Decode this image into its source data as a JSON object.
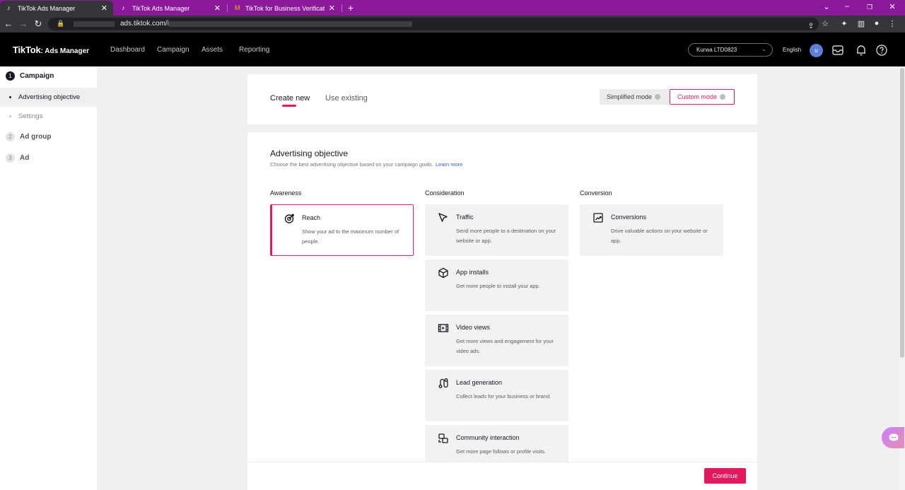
{
  "browser": {
    "tabs": [
      {
        "title": "TikTok Ads Manager",
        "active": true
      },
      {
        "title": "TikTok Ads Manager",
        "active": false
      },
      {
        "title": "TikTok for Business Verification C",
        "active": false
      }
    ],
    "url": "ads.tiktok.com/i"
  },
  "header": {
    "logo": "TikTok",
    "logo_sub": ": Ads Manager",
    "nav": [
      "Dashboard",
      "Campaign",
      "Assets",
      "Reporting"
    ],
    "account": "Kurwa LTD0823",
    "language": "English",
    "avatar_initial": "u"
  },
  "sidebar": {
    "steps": [
      {
        "num": "1",
        "label": "Campaign"
      },
      {
        "num": "2",
        "label": "Ad group"
      },
      {
        "num": "3",
        "label": "Ad"
      }
    ],
    "substeps": [
      "Advertising objective",
      "Settings"
    ]
  },
  "mode_tabs": {
    "create_new": "Create new",
    "use_existing": "Use existing"
  },
  "modes": {
    "simplified": "Simplified mode",
    "custom": "Custom mode"
  },
  "objective": {
    "title": "Advertising objective",
    "subtitle": "Choose the best advertising objective based on your campaign goals.",
    "learn_more": "Learn more",
    "columns": [
      {
        "heading": "Awareness",
        "items": [
          {
            "title": "Reach",
            "desc": "Show your ad to the maximum number of people.",
            "icon": "reach-icon"
          }
        ]
      },
      {
        "heading": "Consideration",
        "items": [
          {
            "title": "Traffic",
            "desc": "Send more people to a destination on your website or app.",
            "icon": "cursor-icon"
          },
          {
            "title": "App installs",
            "desc": "Get more people to install your app.",
            "icon": "cube-icon"
          },
          {
            "title": "Video views",
            "desc": "Get more views and engagement for your video ads.",
            "icon": "film-icon"
          },
          {
            "title": "Lead generation",
            "desc": "Collect leads for your business or brand.",
            "icon": "lead-icon"
          },
          {
            "title": "Community interaction",
            "desc": "Get more page follows or profile visits.",
            "icon": "community-icon"
          }
        ]
      },
      {
        "heading": "Conversion",
        "items": [
          {
            "title": "Conversions",
            "desc": "Drive valuable actions on your website or app.",
            "icon": "trend-chart-icon"
          }
        ]
      }
    ]
  },
  "footer": {
    "continue": "Continue"
  },
  "colors": {
    "accent": "#e3185f",
    "tab_bar": "#8b1a9b",
    "header": "#000000"
  }
}
